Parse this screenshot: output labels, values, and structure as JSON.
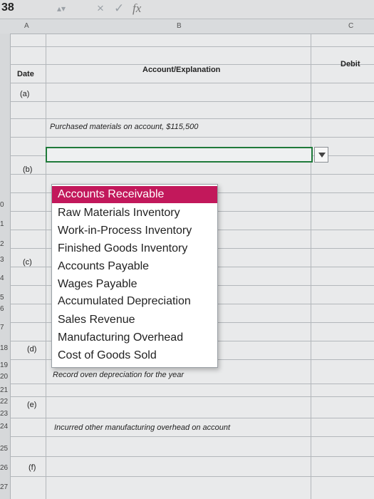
{
  "formula_bar": {
    "name_box": "38",
    "cancel_icon": "×",
    "enter_icon": "✓",
    "function_icon": "fx"
  },
  "columns": {
    "a": "A",
    "b": "B",
    "c": "C"
  },
  "headers": {
    "date": "Date",
    "account": "Account/Explanation",
    "debit": "Debit"
  },
  "row_numbers": [
    "0",
    "1",
    "2",
    "3",
    "4",
    "5",
    "6",
    "7",
    "18",
    "19",
    "20",
    "21",
    "22",
    "23",
    "24",
    "25",
    "26",
    "27"
  ],
  "entries": {
    "a_label": "(a)",
    "a_expl": "Purchased materials on account, $115,500",
    "b_label": "(b)",
    "c_label": "(c)",
    "d_label": "(d)",
    "d_expl": "Record oven depreciation for the year",
    "e_label": "(e)",
    "e_expl": "Incurred other manufacturing overhead on account",
    "f_label": "(f)"
  },
  "dropdown": {
    "options": [
      "Accounts Receivable",
      "Raw Materials Inventory",
      "Work-in-Process Inventory",
      "Finished Goods Inventory",
      "Accounts Payable",
      "Wages Payable",
      "Accumulated Depreciation",
      "Sales Revenue",
      "Manufacturing Overhead",
      "Cost of Goods Sold"
    ],
    "selected": "Accounts Receivable"
  }
}
